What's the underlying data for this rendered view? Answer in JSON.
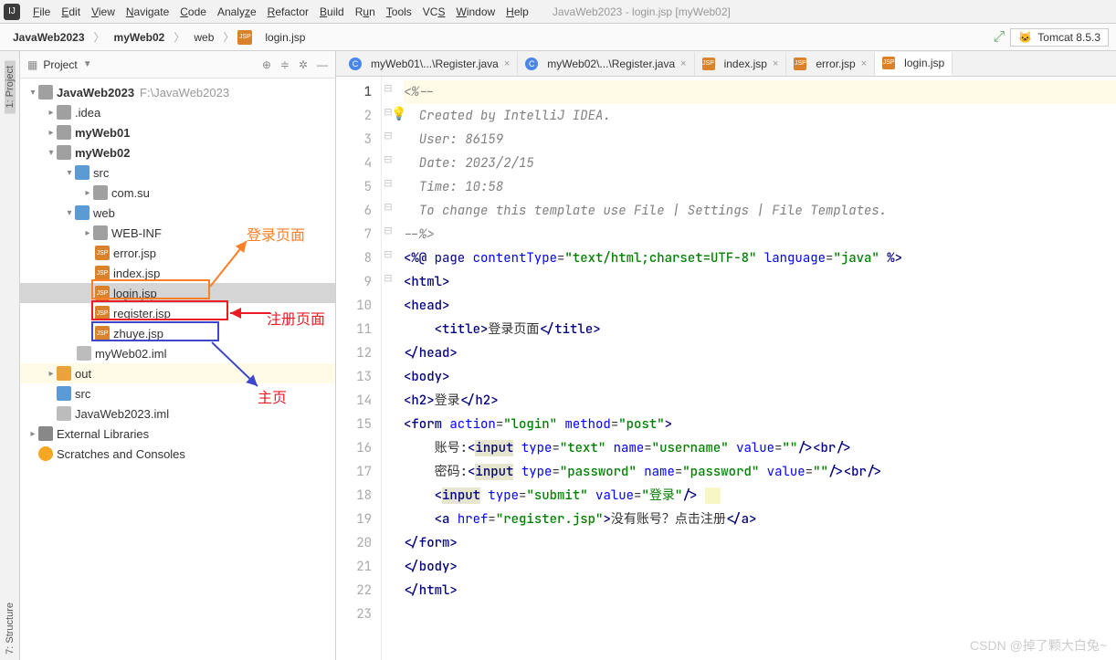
{
  "window_title": "JavaWeb2023 - login.jsp [myWeb02]",
  "menu": [
    "File",
    "Edit",
    "View",
    "Navigate",
    "Code",
    "Analyze",
    "Refactor",
    "Build",
    "Run",
    "Tools",
    "VCS",
    "Window",
    "Help"
  ],
  "run_config": "Tomcat 8.5.3",
  "breadcrumb": [
    "JavaWeb2023",
    "myWeb02",
    "web",
    "login.jsp"
  ],
  "breadcrumb_bold": [
    true,
    true,
    false,
    false
  ],
  "sidebar_tabs": [
    "1: Project",
    "7: Structure"
  ],
  "panel_title": "Project",
  "tree": {
    "root": "JavaWeb2023",
    "root_path": "F:\\JavaWeb2023",
    "idea": ".idea",
    "myweb01": "myWeb01",
    "myweb02": "myWeb02",
    "src": "src",
    "comsu": "com.su",
    "web": "web",
    "webinf": "WEB-INF",
    "errorjsp": "error.jsp",
    "indexjsp": "index.jsp",
    "loginjsp": "login.jsp",
    "registerjsp": "register.jsp",
    "zhuyejsp": "zhuye.jsp",
    "iml": "myWeb02.iml",
    "out": "out",
    "src2": "src",
    "rootiml": "JavaWeb2023.iml",
    "extlib": "External Libraries",
    "scratch": "Scratches and Consoles"
  },
  "annotations": {
    "login": "登录页面",
    "register": "注册页面",
    "zhuye": "主页"
  },
  "tabs": [
    {
      "label": "myWeb01\\...\\Register.java",
      "type": "java"
    },
    {
      "label": "myWeb02\\...\\Register.java",
      "type": "java"
    },
    {
      "label": "index.jsp",
      "type": "jsp"
    },
    {
      "label": "error.jsp",
      "type": "jsp"
    },
    {
      "label": "login.jsp",
      "type": "jsp",
      "active": true
    }
  ],
  "code": {
    "l1": "<%--",
    "l2": "  Created by IntelliJ IDEA.",
    "l3": "  User: 86159",
    "l4": "  Date: 2023/2/15",
    "l5": "  Time: 10:58",
    "l6": "  To change this template use File | Settings | File Templates.",
    "l7": "--%>",
    "l8_pre": "<%@ ",
    "l8_page": "page ",
    "l8_ct": "contentType",
    "l8_ctv": "\"text/html;charset=UTF-8\"",
    "l8_lang": "language",
    "l8_langv": "\"java\"",
    "l8_post": " %>",
    "title_text": "登录页面",
    "h2_text": "登录",
    "action_v": "\"login\"",
    "method_v": "\"post\"",
    "label_user": "账号:",
    "label_pass": "密码:",
    "type_text": "\"text\"",
    "type_pass": "\"password\"",
    "type_submit": "\"submit\"",
    "name_user": "\"username\"",
    "name_pass": "\"password\"",
    "value_empty": "\"\"",
    "value_login": "\"登录\"",
    "href_reg": "\"register.jsp\"",
    "link_text": "没有账号？点击注册"
  },
  "watermark": "CSDN @掉了颗大白兔~"
}
